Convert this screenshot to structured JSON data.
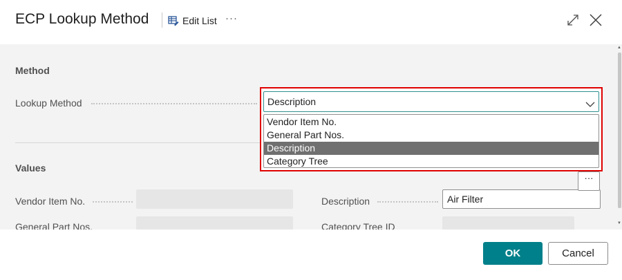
{
  "dialog": {
    "title": "ECP Lookup Method",
    "edit_list_label": "Edit List",
    "more_label": "···"
  },
  "method_section": {
    "title": "Method",
    "lookup_method": {
      "label": "Lookup Method",
      "selected_value": "Description",
      "options": [
        "Vendor Item No.",
        "General Part Nos.",
        "Description",
        "Category Tree"
      ],
      "selected_index": 2
    }
  },
  "values_section": {
    "title": "Values",
    "fields": {
      "vendor_item_no": {
        "label": "Vendor Item No.",
        "value": ""
      },
      "general_part_nos": {
        "label": "General Part Nos.",
        "value": ""
      },
      "description": {
        "label": "Description",
        "value": "Air Filter"
      },
      "category_tree_id": {
        "label": "Category Tree ID",
        "value": "",
        "assist_label": "···"
      }
    }
  },
  "footer": {
    "ok_label": "OK",
    "cancel_label": "Cancel"
  },
  "icons": {
    "edit_list": "edit-list-icon",
    "expand": "expand-icon",
    "close": "close-icon",
    "chevron": "chevron-down-icon"
  },
  "colors": {
    "accent": "#00808a",
    "highlight_outline": "#e00000",
    "selected_option": "#707070",
    "content_background": "#f3f3f3"
  }
}
